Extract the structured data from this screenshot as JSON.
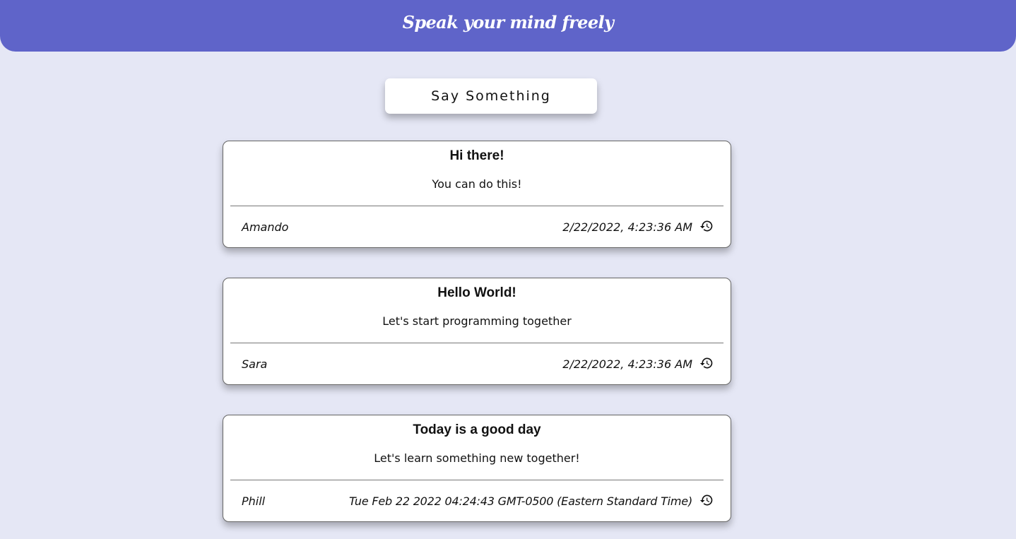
{
  "header": {
    "tagline": "Speak your mind freely",
    "background_color": "#5f64c9"
  },
  "actions": {
    "say_something_label": "Say Something"
  },
  "posts": [
    {
      "title": "Hi there!",
      "body": "You can do this!",
      "author": "Amando",
      "date": "2/22/2022, 4:23:36 AM",
      "icon": "history-icon"
    },
    {
      "title": "Hello World!",
      "body": "Let's start programming together",
      "author": "Sara",
      "date": "2/22/2022, 4:23:36 AM",
      "icon": "history-icon"
    },
    {
      "title": "Today is a good day",
      "body": "Let's learn something new together!",
      "author": "Phill",
      "date": "Tue Feb 22 2022 04:24:43 GMT-0500 (Eastern Standard Time)",
      "icon": "history-icon"
    }
  ],
  "colors": {
    "page_background": "#e5e7f5",
    "card_background": "#ffffff",
    "text": "#111111"
  }
}
